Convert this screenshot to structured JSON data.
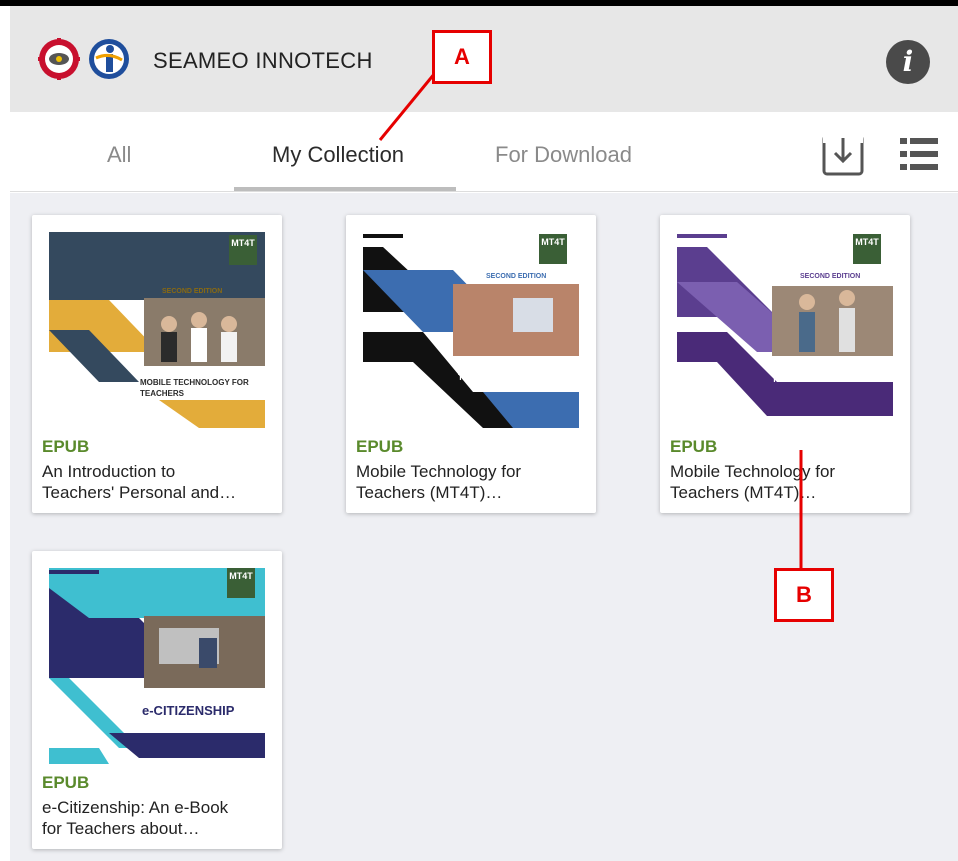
{
  "app": {
    "title": "SEAMEO INNOTECH",
    "info_icon": "info-icon",
    "logo_left": "seameo-seal-logo",
    "logo_right": "innotech-logo"
  },
  "tabs": [
    {
      "label": "All",
      "active": false
    },
    {
      "label": "My Collection",
      "active": true
    },
    {
      "label": "For Download",
      "active": false
    }
  ],
  "toolbar": {
    "download_icon": "download-icon",
    "list_view_icon": "list-view-icon"
  },
  "books": [
    {
      "format": "EPUB",
      "title": "An Introduction to\nTeachers' Personal and…",
      "cover_title": "MOBILE TECHNOLOGY FOR TEACHERS",
      "edition": "SECOND EDITION",
      "badge": "MT4T"
    },
    {
      "format": "EPUB",
      "title": "Mobile Technology for\nTeachers (MT4T)…",
      "cover_title": "MOBILE TECHNOLOGY FOR TEACHERS",
      "edition": "SECOND EDITION",
      "badge": "MT4T"
    },
    {
      "format": "EPUB",
      "title": "Mobile Technology for\nTeachers (MT4T)…",
      "cover_title": "MOBILE TECHNOLOGY FOR TEACHERS",
      "edition": "SECOND EDITION",
      "badge": "MT4T"
    },
    {
      "format": "EPUB",
      "title": "e-Citizenship: An e-Book\nfor Teachers about…",
      "cover_title": "e-CITIZENSHIP",
      "badge": "MT4T"
    }
  ],
  "annotations": {
    "a": "A",
    "b": "B"
  },
  "colors": {
    "format_label": "#5a8a2c",
    "annotation": "#e60000",
    "appbar_bg": "#e7e7e7",
    "grid_bg": "#eeeff3"
  }
}
